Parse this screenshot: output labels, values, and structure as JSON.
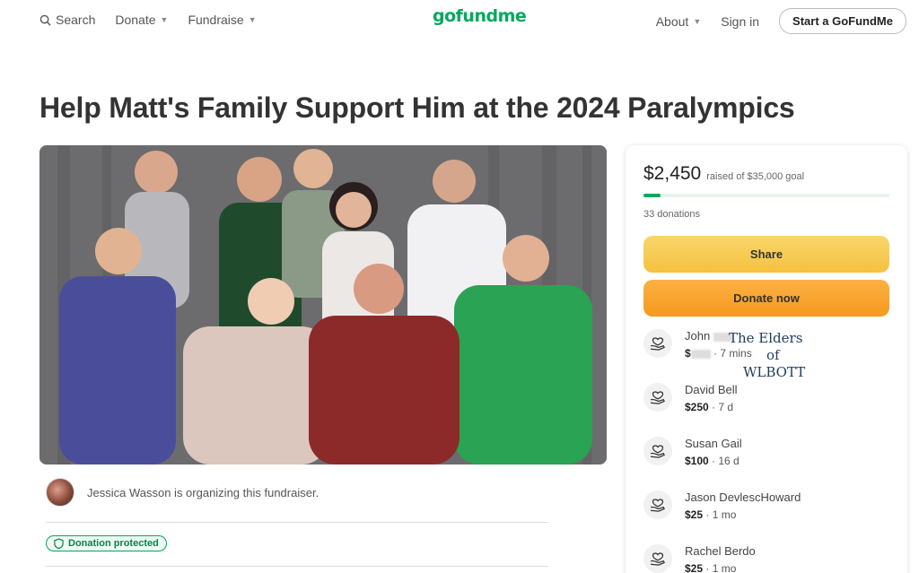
{
  "header": {
    "search_label": "Search",
    "donate_label": "Donate",
    "fundraise_label": "Fundraise",
    "logo_text": "gofundme",
    "about_label": "About",
    "signin_label": "Sign in",
    "start_label": "Start a GoFundMe"
  },
  "page": {
    "title": "Help Matt's Family Support Him at the 2024 Paralympics"
  },
  "organizer": {
    "text": "Jessica Wasson is organizing this fundraiser.",
    "badge": "Donation protected"
  },
  "card": {
    "amount": "$2,450",
    "goal_text": "raised of $35,000 goal",
    "progress_fraction": 0.07,
    "donations_text": "33 donations",
    "share_label": "Share",
    "donate_label": "Donate now",
    "donors": [
      {
        "name": "John",
        "amount": "$",
        "time": "7 mins"
      },
      {
        "name": "David Bell",
        "amount": "$250",
        "time": "7 d"
      },
      {
        "name": "Susan Gail",
        "amount": "$100",
        "time": "16 d"
      },
      {
        "name": "Jason DevlescHoward",
        "amount": "$25",
        "time": "1 mo"
      },
      {
        "name": "Rachel Berdo",
        "amount": "$25",
        "time": "1 mo"
      }
    ]
  },
  "overlay": {
    "line1": "The Elders",
    "line2": "of",
    "line3": "WLBOTT"
  },
  "colors": {
    "brand_green": "#02a95c",
    "share_yellow": "#f7cb50",
    "donate_orange": "#f9a62c"
  }
}
